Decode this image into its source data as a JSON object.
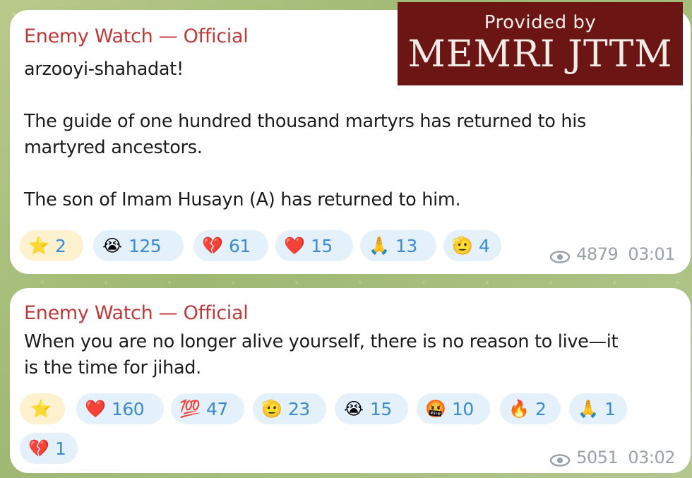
{
  "watermark": {
    "line1": "Provided by",
    "line2": "MEMRI JTTM"
  },
  "messages": [
    {
      "sender": "Enemy Watch — Official",
      "lines": [
        "arzooyi-shahadat!",
        "",
        "The guide of one hundred thousand martyrs has returned to his",
        "martyred ancestors.",
        "",
        "The son of Imam Husayn (A) has returned to him."
      ],
      "reactions": [
        {
          "emoji": "⭐",
          "icon": "star-icon",
          "count": "2",
          "chosen": true
        },
        {
          "emoji": "😭",
          "icon": "crying-face-icon",
          "count": "125"
        },
        {
          "emoji": "💔",
          "icon": "broken-heart-icon",
          "count": "61"
        },
        {
          "emoji": "❤️",
          "icon": "red-heart-icon",
          "count": "15"
        },
        {
          "emoji": "🙏",
          "icon": "praying-hands-icon",
          "count": "13"
        },
        {
          "emoji": "🫡",
          "icon": "salute-icon",
          "count": "4"
        }
      ],
      "views": "4879",
      "time": "03:01"
    },
    {
      "sender": "Enemy Watch — Official",
      "lines": [
        "When you are no longer alive yourself, there is no reason to live—it",
        "is the time for jihad."
      ],
      "reactions": [
        {
          "emoji": "⭐",
          "icon": "star-icon",
          "count": "",
          "chosen": true
        },
        {
          "emoji": "❤️",
          "icon": "red-heart-icon",
          "count": "160"
        },
        {
          "emoji": "💯",
          "icon": "hundred-points-icon",
          "count": "47"
        },
        {
          "emoji": "🫡",
          "icon": "salute-icon",
          "count": "23"
        },
        {
          "emoji": "😭",
          "icon": "crying-face-icon",
          "count": "15"
        },
        {
          "emoji": "🤬",
          "icon": "cursing-face-icon",
          "count": "10"
        },
        {
          "emoji": "🔥",
          "icon": "fire-icon",
          "count": "2"
        },
        {
          "emoji": "🙏",
          "icon": "praying-hands-icon",
          "count": "1"
        },
        {
          "emoji": "💔",
          "icon": "broken-heart-icon",
          "count": "1"
        }
      ],
      "views": "5051",
      "time": "03:02"
    }
  ],
  "colors": {
    "sender": "#c0393a",
    "reaction_bg": "#e4f0fa",
    "reaction_count": "#3a8ad6",
    "chosen_bg": "#fdf1cf",
    "watermark_bg": "#6b1614"
  }
}
